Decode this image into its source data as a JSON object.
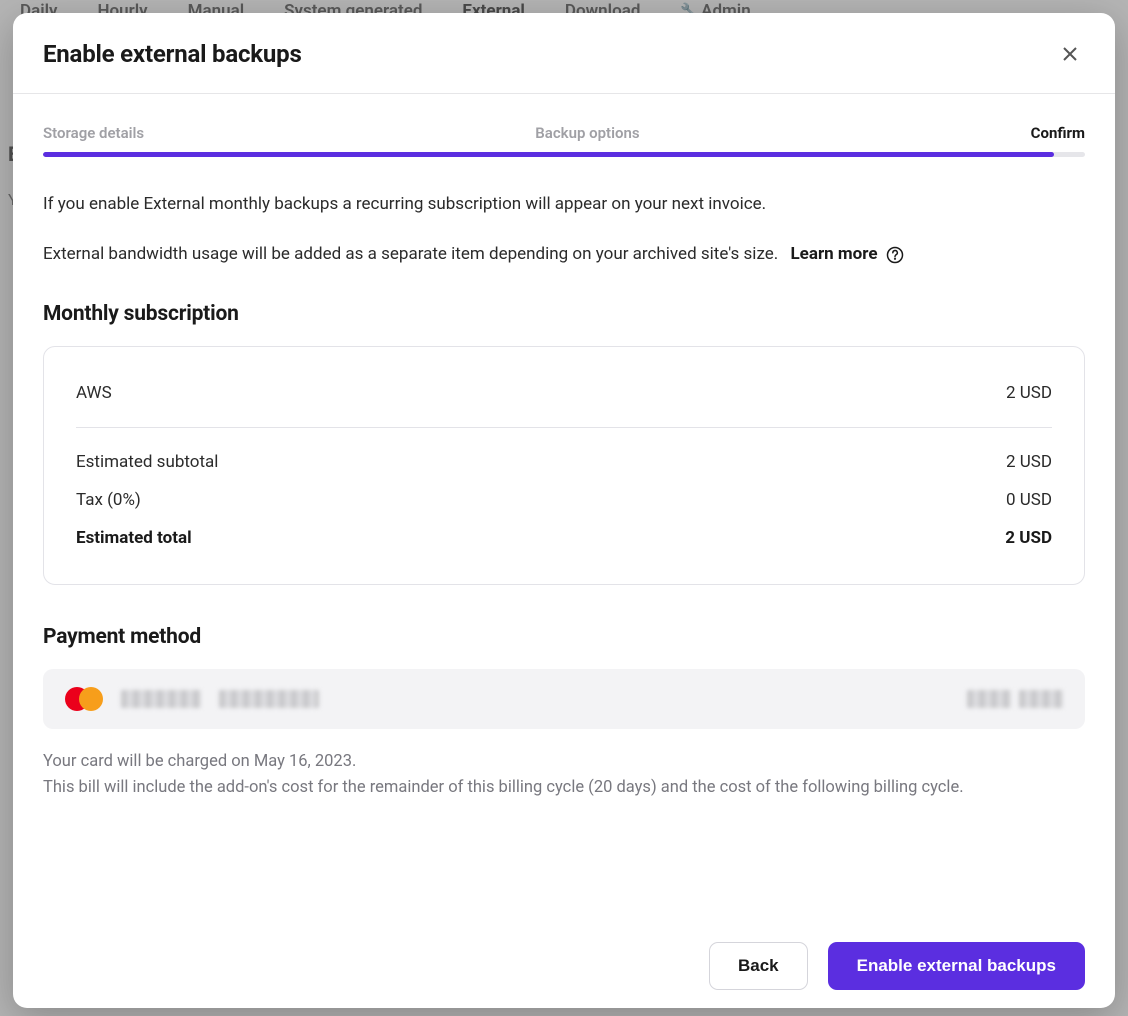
{
  "bg_tabs": {
    "items": [
      "Daily",
      "Hourly",
      "Manual",
      "System generated",
      "External",
      "Download",
      "Admin"
    ],
    "active_index": 4
  },
  "bg_heading_initial": "E",
  "bg_subtext_initial": "Y",
  "modal": {
    "title": "Enable external backups",
    "steps": {
      "items": [
        "Storage details",
        "Backup options",
        "Confirm"
      ],
      "active_index": 2,
      "progress_percent": 97
    },
    "intro_line1": "If you enable External monthly backups a recurring subscription will appear on your next invoice.",
    "intro_line2": "External bandwidth usage will be added as a separate item depending on your archived site's size.",
    "learn_more_label": "Learn more",
    "subscription": {
      "heading": "Monthly subscription",
      "line_item_label": "AWS",
      "line_item_value": "2 USD",
      "subtotal_label": "Estimated subtotal",
      "subtotal_value": "2 USD",
      "tax_label": "Tax (0%)",
      "tax_value": "0 USD",
      "total_label": "Estimated total",
      "total_value": "2 USD"
    },
    "payment": {
      "heading": "Payment method",
      "card_brand": "mastercard",
      "charge_note_line1": "Your card will be charged on May 16, 2023.",
      "charge_note_line2": "This bill will include the add-on's cost for the remainder of this billing cycle (20 days) and the cost of the following billing cycle."
    },
    "footer": {
      "back_label": "Back",
      "primary_label": "Enable external backups"
    }
  }
}
